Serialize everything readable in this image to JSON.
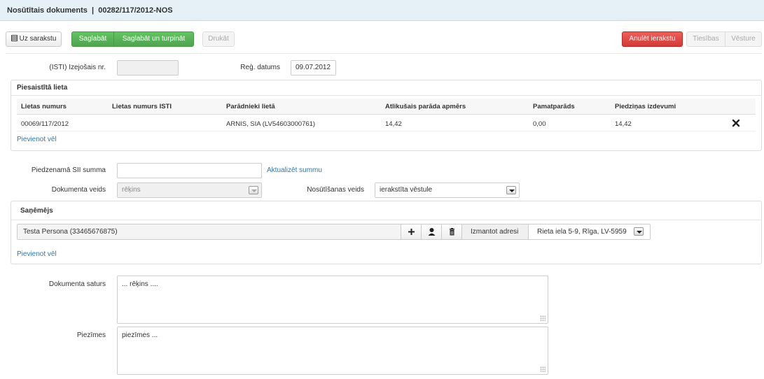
{
  "header": {
    "title": "Nosūtītais dokuments  |  00282/117/2012-NOS"
  },
  "toolbar": {
    "back_label": "Uz sarakstu",
    "save_label": "Saglabāt",
    "save_continue_label": "Saglabāt un turpināt",
    "print_label": "Drukāt",
    "cancel_label": "Anulēt ierakstu",
    "rights_label": "Tiesības",
    "history_label": "Vēsture"
  },
  "meta": {
    "outgoing_no_label": "(ISTI) Izejošais nr.",
    "outgoing_no_value": "",
    "reg_date_label": "Reģ. datums",
    "reg_date_value": "09.07.2012"
  },
  "attached_case": {
    "title": "Piesaistītā lieta",
    "columns": [
      "Lietas numurs",
      "Lietas numurs ISTI",
      "Parādnieki lietā",
      "Atlikušais parāda apmērs",
      "Pamatparāds",
      "Piedziņas izdevumi"
    ],
    "rows": [
      {
        "case_no": "00069/117/2012",
        "isti_no": "",
        "debtors": "ARNIS, SIA (LV54603000761)",
        "remaining": "14,42",
        "principal": "0,00",
        "costs": "14,42"
      }
    ],
    "add_more": "Pievienot vēl"
  },
  "form": {
    "amount_label": "Piedzenamā SII summa",
    "amount_value": "",
    "update_amount_link": "Aktualizēt summu",
    "doc_type_label": "Dokumenta veids",
    "doc_type_value": "rēķins",
    "send_type_label": "Nosūtīšanas veids",
    "send_type_value": "ierakstīta vēstule"
  },
  "recipient": {
    "title": "Saņēmējs",
    "name": "Testa Persona (33465676875)",
    "use_address_label": "Izmantot adresi",
    "address_value": "Rieta iela 5-9, Rīga, LV-5959",
    "add_more": "Pievienot vēl"
  },
  "content": {
    "label": "Dokumenta saturs",
    "value": "... rēķins ...."
  },
  "notes": {
    "label": "Piezīmes",
    "value": "piezīmes ..."
  }
}
